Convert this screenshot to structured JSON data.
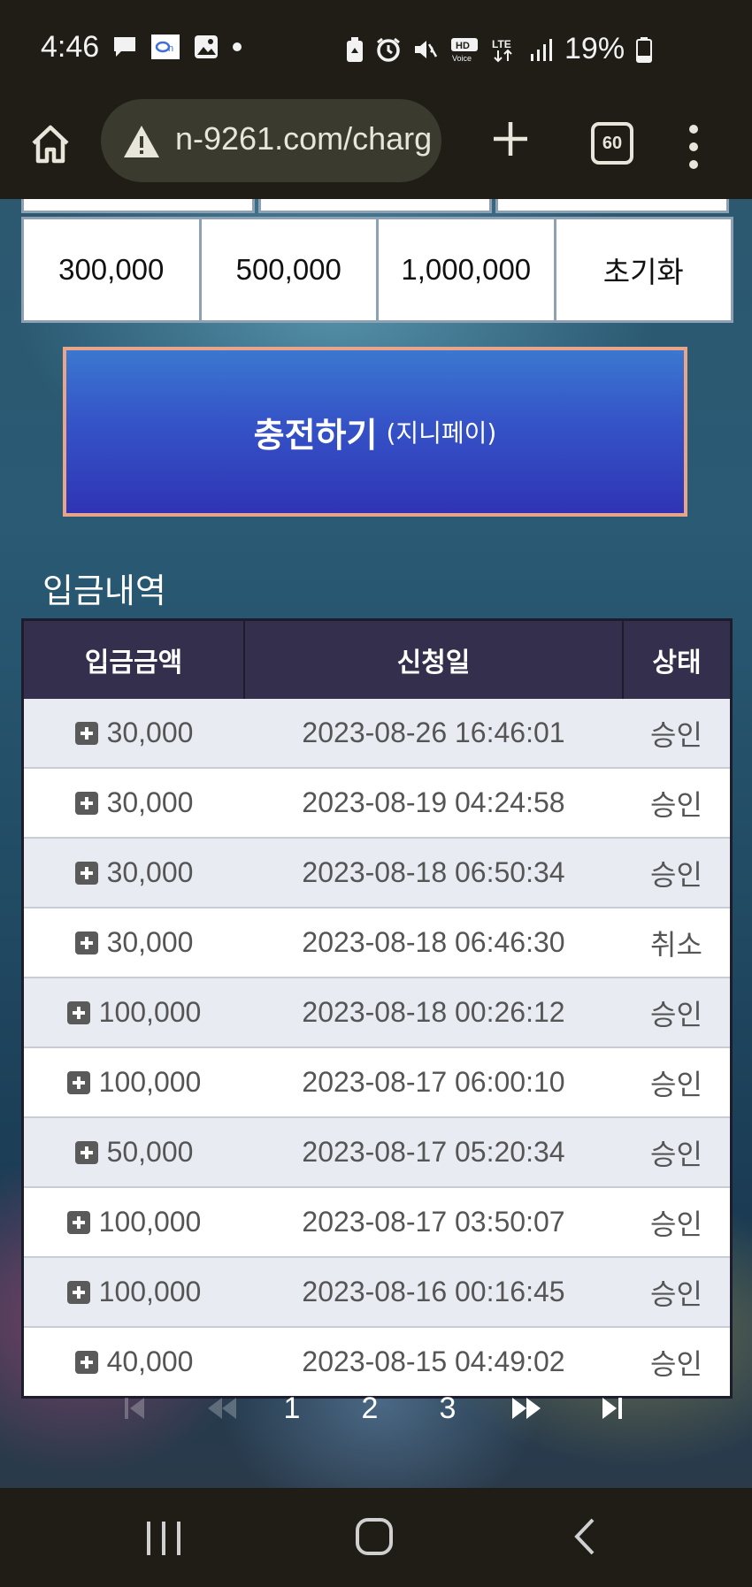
{
  "status_bar": {
    "time": "4:46",
    "battery_pct": "19%",
    "icons": [
      "chat-icon",
      "app-icon",
      "image-icon",
      "dot-icon",
      "recycle-icon",
      "alarm-icon",
      "mute-icon",
      "hd-voice-icon",
      "lte-icon",
      "signal-icon",
      "battery-icon"
    ]
  },
  "browser": {
    "url": "n-9261.com/charg",
    "tab_count": "60"
  },
  "amounts": [
    "300,000",
    "500,000",
    "1,000,000",
    "초기화"
  ],
  "charge_button": {
    "main": "충전하기",
    "sub": "(지니페이)"
  },
  "history": {
    "title": "입금내역",
    "headers": [
      "입금금액",
      "신청일",
      "상태"
    ],
    "rows": [
      {
        "amount": "30,000",
        "date": "2023-08-26 16:46:01",
        "status": "승인"
      },
      {
        "amount": "30,000",
        "date": "2023-08-19 04:24:58",
        "status": "승인"
      },
      {
        "amount": "30,000",
        "date": "2023-08-18 06:50:34",
        "status": "승인"
      },
      {
        "amount": "30,000",
        "date": "2023-08-18 06:46:30",
        "status": "취소"
      },
      {
        "amount": "100,000",
        "date": "2023-08-18 00:26:12",
        "status": "승인"
      },
      {
        "amount": "100,000",
        "date": "2023-08-17 06:00:10",
        "status": "승인"
      },
      {
        "amount": "50,000",
        "date": "2023-08-17 05:20:34",
        "status": "승인"
      },
      {
        "amount": "100,000",
        "date": "2023-08-17 03:50:07",
        "status": "승인"
      },
      {
        "amount": "100,000",
        "date": "2023-08-16 00:16:45",
        "status": "승인"
      },
      {
        "amount": "40,000",
        "date": "2023-08-15 04:49:02",
        "status": "승인"
      }
    ]
  },
  "pagination": {
    "pages": [
      "1",
      "2",
      "3"
    ]
  }
}
